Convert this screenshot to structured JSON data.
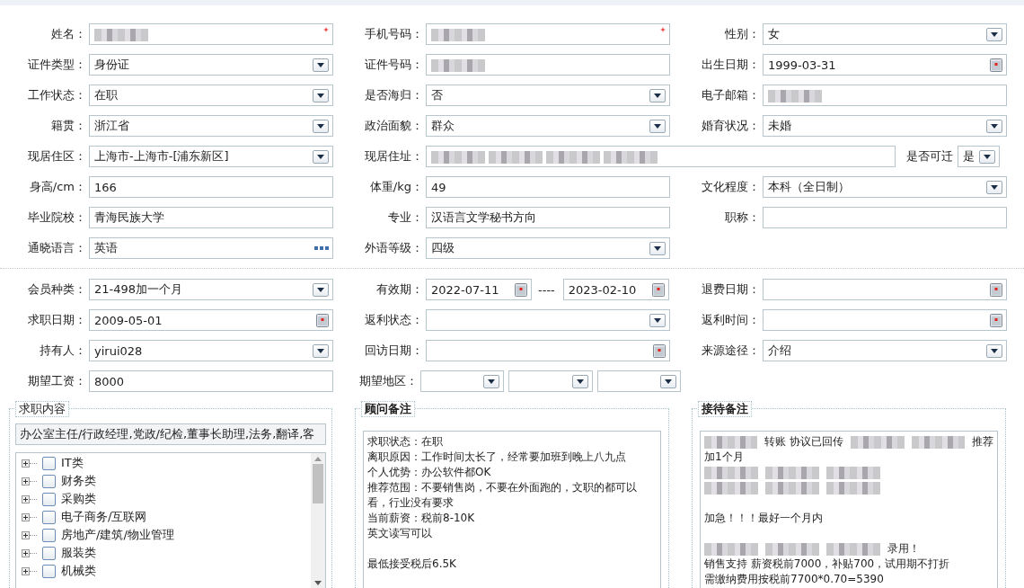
{
  "sections": [
    {
      "rows": [
        {
          "fields": [
            {
              "kind": "text",
              "label": "姓名：",
              "blurred": true,
              "required": true
            },
            {
              "kind": "text",
              "label": "手机号码：",
              "blurred": true,
              "required": true
            },
            {
              "kind": "select",
              "label": "性别：",
              "value": "女"
            }
          ]
        },
        {
          "fields": [
            {
              "kind": "select",
              "label": "证件类型：",
              "value": "身份证"
            },
            {
              "kind": "text",
              "label": "证件号码：",
              "blurred": true
            },
            {
              "kind": "date",
              "label": "出生日期：",
              "value": "1999-03-31"
            }
          ]
        },
        {
          "fields": [
            {
              "kind": "select",
              "label": "工作状态：",
              "value": "在职"
            },
            {
              "kind": "select",
              "label": "是否海归：",
              "value": "否"
            },
            {
              "kind": "text",
              "label": "电子邮箱：",
              "blurred": true
            }
          ]
        },
        {
          "fields": [
            {
              "kind": "select",
              "label": "籍贯：",
              "value": "浙江省"
            },
            {
              "kind": "select",
              "label": "政治面貌：",
              "value": "群众"
            },
            {
              "kind": "select",
              "label": "婚育状况：",
              "value": "未婚"
            }
          ]
        },
        {
          "fields": [
            {
              "kind": "select",
              "label": "现居住区：",
              "value": "上海市-上海市-[浦东新区]"
            },
            {
              "kind": "address",
              "label": "现居住址：",
              "blurred": true,
              "transfer": {
                "label": "是否可迁",
                "value": "是"
              }
            }
          ]
        },
        {
          "fields": [
            {
              "kind": "text",
              "label": "身高/cm：",
              "value": "166"
            },
            {
              "kind": "text",
              "label": "体重/kg：",
              "value": "49"
            },
            {
              "kind": "select",
              "label": "文化程度：",
              "value": "本科（全日制）"
            }
          ]
        },
        {
          "fields": [
            {
              "kind": "text",
              "label": "毕业院校：",
              "value": "青海民族大学"
            },
            {
              "kind": "text",
              "label": "专业：",
              "value": "汉语言文学秘书方向"
            },
            {
              "kind": "text",
              "label": "职称："
            }
          ]
        },
        {
          "fields": [
            {
              "kind": "lookup",
              "label": "通晓语言：",
              "value": "英语"
            },
            {
              "kind": "select",
              "label": "外语等级：",
              "value": "四级"
            }
          ]
        }
      ]
    },
    {
      "rows": [
        {
          "fields": [
            {
              "kind": "select",
              "label": "会员种类：",
              "value": "21-498加一个月"
            },
            {
              "kind": "daterange",
              "label": "有效期：",
              "values": [
                "2022-07-11",
                "2023-02-10"
              ],
              "separator": "----"
            },
            {
              "kind": "date",
              "label": "退费日期："
            }
          ]
        },
        {
          "fields": [
            {
              "kind": "date",
              "label": "求职日期：",
              "value": "2009-05-01"
            },
            {
              "kind": "select",
              "label": "返利状态："
            },
            {
              "kind": "date",
              "label": "返利时间："
            }
          ]
        },
        {
          "fields": [
            {
              "kind": "select",
              "label": "持有人：",
              "value": "yirui028"
            },
            {
              "kind": "date",
              "label": "回访日期："
            },
            {
              "kind": "select",
              "label": "来源途径：",
              "value": "介绍"
            }
          ]
        },
        {
          "fields": [
            {
              "kind": "text",
              "label": "期望工资：",
              "value": "8000"
            },
            {
              "kind": "multiselect",
              "label": "期望地区：",
              "selects": [
                {
                  "kind": "select"
                },
                {
                  "kind": "select"
                },
                {
                  "kind": "select"
                }
              ]
            }
          ]
        }
      ]
    }
  ],
  "panels": [
    {
      "kind": "tree",
      "title": "求职内容",
      "value": "办公室主任/行政经理,党政/纪检,董事长助理,法务,翻译,客",
      "items": [
        {
          "label": "IT类",
          "expanded": false,
          "checked": false
        },
        {
          "label": "财务类",
          "expanded": false,
          "checked": false
        },
        {
          "label": "采购类",
          "expanded": false,
          "checked": false
        },
        {
          "label": "电子商务/互联网",
          "expanded": false,
          "checked": false
        },
        {
          "label": "房地产/建筑/物业管理",
          "expanded": false,
          "checked": false
        },
        {
          "label": "服装类",
          "expanded": false,
          "checked": false
        },
        {
          "label": "机械类",
          "expanded": false,
          "checked": false
        }
      ]
    },
    {
      "kind": "notes",
      "title": "顾问备注",
      "paragraphs": [
        [
          "求职状态：在职",
          "离职原因：工作时间太长了，经常要加班到晚上八九点",
          "个人优势：办公软件都OK",
          "推荐范围：不要销售岗，不要在外面跑的，文职的都可以看，行业没有要求",
          "当前薪资：税前8-10K",
          "英文读写可以"
        ],
        [
          "最低接受税后6.5K"
        ]
      ]
    },
    {
      "kind": "notes",
      "title": "接待备注",
      "paragraphs": [
        [
          [
            {
              "kind": "blur"
            },
            {
              "kind": "text",
              "text": "转账  协议已回传"
            },
            {
              "kind": "blur"
            },
            {
              "kind": "blur"
            },
            {
              "kind": "text",
              "text": "推荐"
            }
          ],
          "加1个月",
          [
            {
              "kind": "blur"
            },
            {
              "kind": "blur"
            },
            {
              "kind": "blur"
            }
          ],
          [
            {
              "kind": "blur"
            },
            {
              "kind": "blur"
            },
            {
              "kind": "blur"
            }
          ]
        ],
        [
          "加急！！！最好一个月内"
        ],
        [
          [
            {
              "kind": "blur"
            },
            {
              "kind": "blur"
            },
            {
              "kind": "blur"
            },
            {
              "kind": "text",
              "text": "录用！"
            }
          ],
          "销售支持 薪资税前7000，补贴700，试用期不打折",
          "需缴纳费用按税前7700*0.70=5390"
        ]
      ]
    }
  ]
}
